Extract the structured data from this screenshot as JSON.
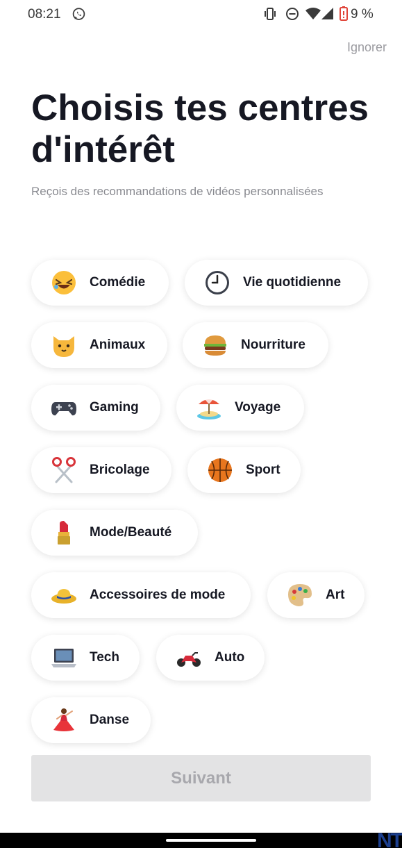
{
  "status_bar": {
    "time": "08:21",
    "battery": "9 %",
    "icons": [
      "whatsapp-icon",
      "vibrate-icon",
      "do-not-disturb-icon",
      "wifi-icon",
      "signal-icon",
      "battery-low-icon"
    ]
  },
  "header": {
    "skip_label": "Ignorer"
  },
  "page": {
    "title": "Choisis tes centres d'intérêt",
    "subtitle": "Reçois des recommandations de vidéos personnalisées"
  },
  "interests": [
    {
      "label": "Comédie",
      "icon": "laughing-face-icon"
    },
    {
      "label": "Vie quotidienne",
      "icon": "clock-icon"
    },
    {
      "label": "Animaux",
      "icon": "cat-face-icon"
    },
    {
      "label": "Nourriture",
      "icon": "hamburger-icon"
    },
    {
      "label": "Gaming",
      "icon": "game-controller-icon"
    },
    {
      "label": "Voyage",
      "icon": "beach-umbrella-icon"
    },
    {
      "label": "Bricolage",
      "icon": "scissors-icon"
    },
    {
      "label": "Sport",
      "icon": "basketball-icon"
    },
    {
      "label": "Mode/Beauté",
      "icon": "lipstick-icon"
    },
    {
      "label": "Accessoires de mode",
      "icon": "sun-hat-icon"
    },
    {
      "label": "Art",
      "icon": "palette-icon"
    },
    {
      "label": "Tech",
      "icon": "laptop-icon"
    },
    {
      "label": "Auto",
      "icon": "motorcycle-icon"
    },
    {
      "label": "Danse",
      "icon": "dancer-icon"
    }
  ],
  "footer": {
    "next_label": "Suivant",
    "next_enabled": false
  },
  "colors": {
    "text_primary": "#161823",
    "text_secondary": "#8a8b91",
    "button_disabled_bg": "#e3e3e4",
    "button_disabled_text": "#a8a8ad"
  }
}
